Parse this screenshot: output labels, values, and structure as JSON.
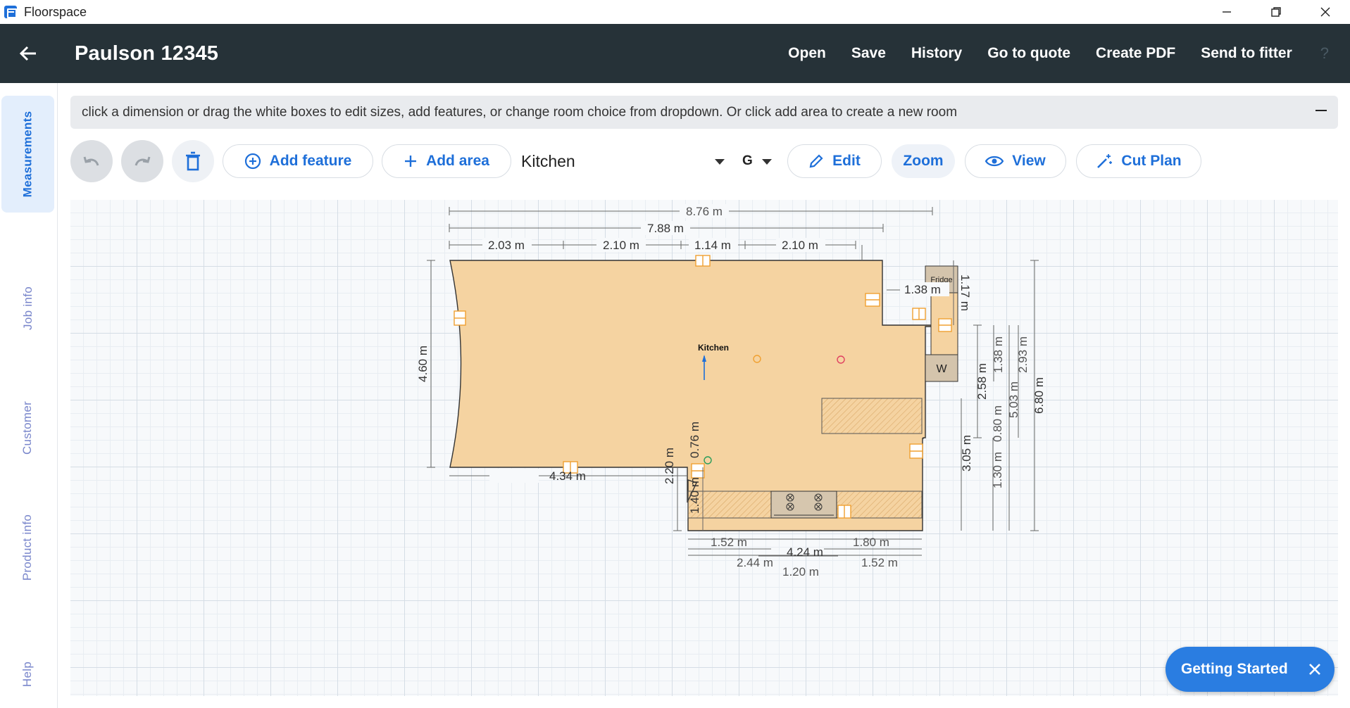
{
  "window": {
    "app_name": "Floorspace",
    "controls": [
      "minimize-icon",
      "restore-icon",
      "close-icon"
    ]
  },
  "header": {
    "title": "Paulson 12345",
    "menu": [
      "Open",
      "Save",
      "History",
      "Go to quote",
      "Create PDF",
      "Send to fitter"
    ],
    "help": "?"
  },
  "sidenav": {
    "items": [
      "Measurements",
      "Job info",
      "Customer",
      "Product info",
      "Help"
    ],
    "active": "Measurements"
  },
  "instruction": "click a dimension or drag the white boxes to edit sizes, add features, or change room choice from dropdown. Or click add area to create a new room",
  "toolbar": {
    "add_feature": "Add feature",
    "add_area": "Add area",
    "room": "Kitchen",
    "floor": "G",
    "edit": "Edit",
    "zoom": "Zoom",
    "view": "View",
    "cut_plan": "Cut Plan"
  },
  "plan": {
    "room_label": "Kitchen",
    "fridge_label": "Fridge",
    "washer_label": "W",
    "dims": {
      "d876": "8.76 m",
      "d788": "7.88 m",
      "d203": "2.03 m",
      "d210a": "2.10 m",
      "d114": "1.14 m",
      "d210b": "2.10 m",
      "d138a": "1.38 m",
      "d117": "1.17 m",
      "d460": "4.60 m",
      "d434": "4.34 m",
      "d258": "2.58 m",
      "d138b": "1.38 m",
      "d293": "2.93 m",
      "d503": "5.03 m",
      "d680": "6.80 m",
      "d080": "0.80 m",
      "d130": "1.30 m",
      "d305": "3.05 m",
      "d076": "0.76 m",
      "d220": "2.20 m",
      "d140": "1.40 m",
      "d152a": "1.52 m",
      "d180": "1.80 m",
      "d424": "4.24 m",
      "d244": "2.44 m",
      "d152b": "1.52 m",
      "d120": "1.20 m"
    }
  },
  "getting_started": "Getting Started",
  "colors": {
    "appbar": "#263238",
    "accent": "#1e6fd9",
    "floor": "#f5d3a1",
    "feature": "#f0a030"
  }
}
